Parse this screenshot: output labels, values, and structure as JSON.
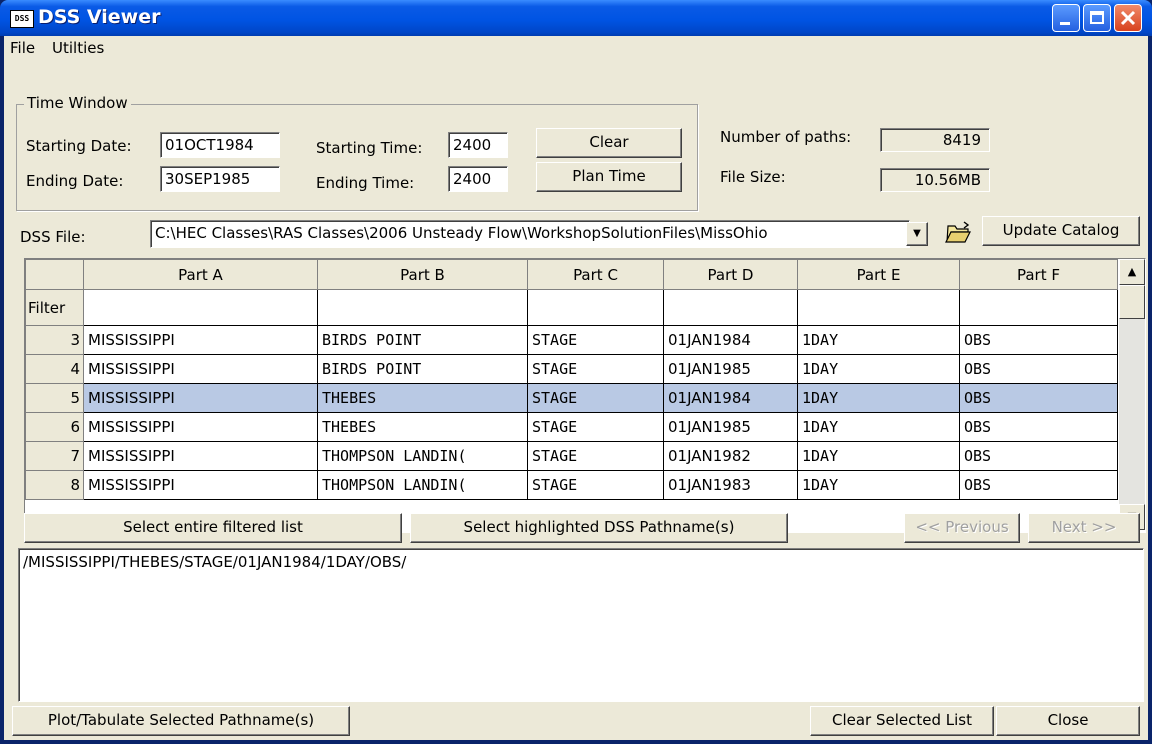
{
  "window": {
    "title": "DSS Viewer",
    "icon_text": "DSS"
  },
  "menu": [
    "File",
    "Utilties"
  ],
  "time_window": {
    "legend": "Time Window",
    "starting_date_label": "Starting Date:",
    "starting_date": "01OCT1984",
    "ending_date_label": "Ending Date:",
    "ending_date": "30SEP1985",
    "starting_time_label": "Starting Time:",
    "starting_time": "2400",
    "ending_time_label": "Ending Time:",
    "ending_time": "2400",
    "clear_label": "Clear",
    "plan_time_label": "Plan Time"
  },
  "info": {
    "paths_label": "Number of paths:",
    "paths_value": "8419",
    "size_label": "File Size:",
    "size_value": "10.56MB"
  },
  "dss_file": {
    "label": "DSS File:",
    "path": "C:\\HEC Classes\\RAS Classes\\2006 Unsteady Flow\\WorkshopSolutionFiles\\MissOhio",
    "update_label": "Update Catalog"
  },
  "grid": {
    "filter_label": "Filter",
    "columns": [
      "Part A",
      "Part B",
      "Part C",
      "Part D",
      "Part E",
      "Part F"
    ],
    "rows": [
      {
        "n": "3",
        "a": "MISSISSIPPI",
        "b": "BIRDS POINT",
        "c": "STAGE",
        "d": "01JAN1984",
        "e": "1DAY",
        "f": "OBS"
      },
      {
        "n": "4",
        "a": "MISSISSIPPI",
        "b": "BIRDS POINT",
        "c": "STAGE",
        "d": "01JAN1985",
        "e": "1DAY",
        "f": "OBS"
      },
      {
        "n": "5",
        "a": "MISSISSIPPI",
        "b": "THEBES",
        "c": "STAGE",
        "d": "01JAN1984",
        "e": "1DAY",
        "f": "OBS"
      },
      {
        "n": "6",
        "a": "MISSISSIPPI",
        "b": "THEBES",
        "c": "STAGE",
        "d": "01JAN1985",
        "e": "1DAY",
        "f": "OBS"
      },
      {
        "n": "7",
        "a": "MISSISSIPPI",
        "b": "THOMPSON LANDIN(",
        "c": "STAGE",
        "d": "01JAN1982",
        "e": "1DAY",
        "f": "OBS"
      },
      {
        "n": "8",
        "a": "MISSISSIPPI",
        "b": "THOMPSON LANDIN(",
        "c": "STAGE",
        "d": "01JAN1983",
        "e": "1DAY",
        "f": "OBS"
      }
    ],
    "selected_row": "5"
  },
  "actions": {
    "select_filtered": "Select entire filtered list",
    "select_highlighted": "Select highlighted DSS Pathname(s)",
    "previous": "<< Previous",
    "next": "Next >>"
  },
  "selected_paths": [
    "/MISSISSIPPI/THEBES/STAGE/01JAN1984/1DAY/OBS/"
  ],
  "footer": {
    "plot_label": "Plot/Tabulate Selected Pathname(s)",
    "clear_list_label": "Clear Selected List",
    "close_label": "Close"
  }
}
